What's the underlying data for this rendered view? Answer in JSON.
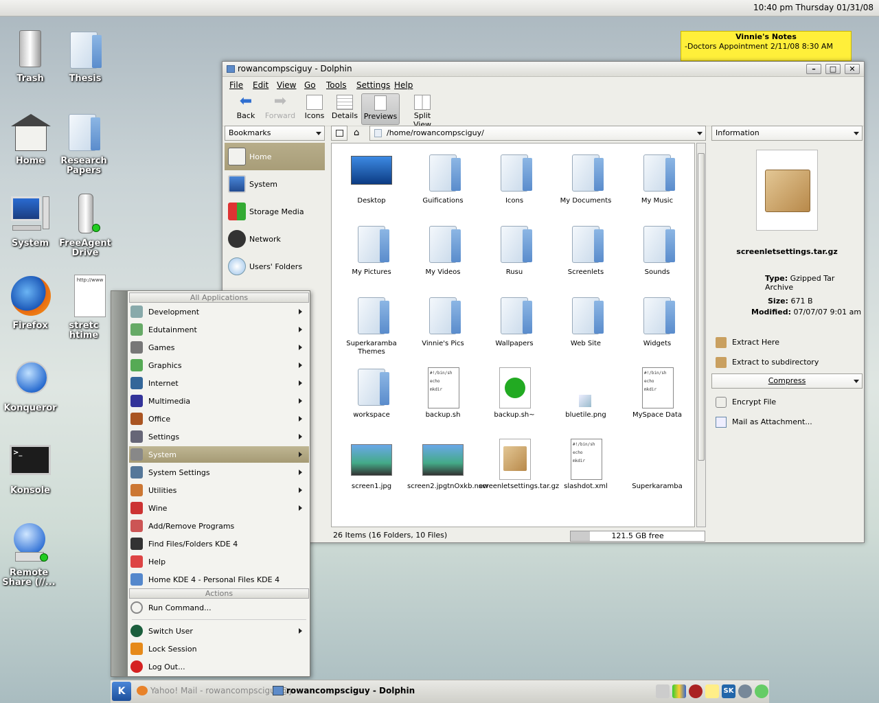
{
  "topbar": {
    "clock": "10:40 pm  Thursday  01/31/08"
  },
  "desktop_icons": [
    {
      "label": "Trash",
      "icon": "trash-icon"
    },
    {
      "label": "Thesis",
      "icon": "folder-icon"
    },
    {
      "label": "Home",
      "icon": "home-icon"
    },
    {
      "label": "Research Papers",
      "icon": "folder-icon"
    },
    {
      "label": "System",
      "icon": "computer-icon"
    },
    {
      "label": "FreeAgent Drive",
      "icon": "usb-drive-icon"
    },
    {
      "label": "Firefox",
      "icon": "firefox-icon"
    },
    {
      "label": "stretchtime",
      "icon": "html-file-icon"
    },
    {
      "label": "Konqueror",
      "icon": "konqueror-icon"
    },
    {
      "label": "Konsole",
      "icon": "terminal-icon"
    },
    {
      "label": "Remote Share (//...",
      "icon": "network-share-icon"
    }
  ],
  "note": {
    "title": "Vinnie's Notes",
    "body": "-Doctors Appointment 2/11/08 8:30 AM"
  },
  "dolphin": {
    "title": "rowancompsciguy - Dolphin",
    "menu": [
      "File",
      "Edit",
      "View",
      "Go",
      "Tools",
      "Settings",
      "Help"
    ],
    "toolbar": {
      "back": "Back",
      "forward": "Forward",
      "icons": "Icons",
      "details": "Details",
      "previews": "Previews",
      "split": "Split View"
    },
    "bookmarks_label": "Bookmarks",
    "path": "/home/rowancompsciguy/",
    "places": [
      "Home",
      "System",
      "Storage Media",
      "Network",
      "Users' Folders"
    ],
    "files": [
      {
        "name": "Desktop",
        "kind": "desktop"
      },
      {
        "name": "Guifications",
        "kind": "folder"
      },
      {
        "name": "Icons",
        "kind": "folder"
      },
      {
        "name": "My Documents",
        "kind": "folder"
      },
      {
        "name": "My Music",
        "kind": "folder"
      },
      {
        "name": "My Pictures",
        "kind": "folder"
      },
      {
        "name": "My Videos",
        "kind": "folder"
      },
      {
        "name": "Rusu",
        "kind": "folder"
      },
      {
        "name": "Screenlets",
        "kind": "folder"
      },
      {
        "name": "Sounds",
        "kind": "folder"
      },
      {
        "name": "Superkaramba Themes",
        "kind": "folder"
      },
      {
        "name": "Vinnie's Pics",
        "kind": "folder"
      },
      {
        "name": "Wallpapers",
        "kind": "folder"
      },
      {
        "name": "Web Site",
        "kind": "folder"
      },
      {
        "name": "Widgets",
        "kind": "folder"
      },
      {
        "name": "workspace",
        "kind": "folder"
      },
      {
        "name": "backup.sh",
        "kind": "script"
      },
      {
        "name": "backup.sh~",
        "kind": "backup"
      },
      {
        "name": "bluetile.png",
        "kind": "image"
      },
      {
        "name": "MySpace Data",
        "kind": "text"
      },
      {
        "name": "screen1.jpg",
        "kind": "photo"
      },
      {
        "name": "screen2.jpgtnOxkb.new",
        "kind": "photo"
      },
      {
        "name": "screenletsettings.tar.gz",
        "kind": "archive"
      },
      {
        "name": "slashdot.xml",
        "kind": "xml"
      },
      {
        "name": "Superkaramba",
        "kind": "blank"
      }
    ],
    "status": "26 Items (16 Folders, 10 Files)",
    "free_space": "121.5 GB free",
    "info": {
      "panel_label": "Information",
      "filename": "screenletsettings.tar.gz",
      "type_label": "Type:",
      "type": "Gzipped Tar Archive",
      "size_label": "Size:",
      "size": "671 B",
      "modified_label": "Modified:",
      "modified": "07/07/07 9:01 am",
      "actions": [
        "Extract Here",
        "Extract to subdirectory"
      ],
      "compress": "Compress",
      "actions2": [
        "Encrypt File",
        "Mail as Attachment..."
      ]
    }
  },
  "kmenu": {
    "all_apps": "All Applications",
    "apps": [
      {
        "label": "Development",
        "sub": true
      },
      {
        "label": "Edutainment",
        "sub": true
      },
      {
        "label": "Games",
        "sub": true
      },
      {
        "label": "Graphics",
        "sub": true
      },
      {
        "label": "Internet",
        "sub": true
      },
      {
        "label": "Multimedia",
        "sub": true
      },
      {
        "label": "Office",
        "sub": true
      },
      {
        "label": "Settings",
        "sub": true
      },
      {
        "label": "System",
        "sub": true
      },
      {
        "label": "System Settings",
        "sub": true
      },
      {
        "label": "Utilities",
        "sub": true
      },
      {
        "label": "Wine",
        "sub": true
      },
      {
        "label": "Add/Remove Programs",
        "sub": false
      },
      {
        "label": "Find Files/Folders KDE 4",
        "sub": false
      },
      {
        "label": "Help",
        "sub": false
      },
      {
        "label": "Home KDE 4 - Personal Files KDE 4",
        "sub": false
      }
    ],
    "actions_label": "Actions",
    "run": "Run Command...",
    "switch": "Switch User",
    "lock": "Lock Session",
    "logout": "Log Out..."
  },
  "taskbar": {
    "task1": "Yahoo! Mail - rowancompsciguy@y",
    "task2": "rowancompsciguy - Dolphin"
  },
  "colors": {
    "accent": "#b4aa86",
    "note": "#ffef3a"
  }
}
